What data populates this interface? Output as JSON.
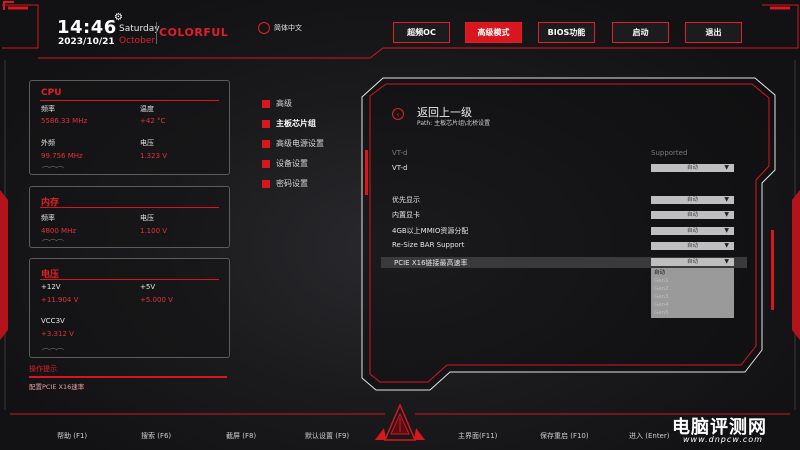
{
  "header": {
    "time": "14:46",
    "weekday": "Saturday",
    "date": "2023/10/21",
    "month": "October",
    "brand": "COLORFUL",
    "language": "简体中文"
  },
  "tabs": [
    {
      "label": "超频OC",
      "active": false
    },
    {
      "label": "高级模式",
      "active": true
    },
    {
      "label": "BIOS功能",
      "active": false
    },
    {
      "label": "启动",
      "active": false
    },
    {
      "label": "退出",
      "active": false
    }
  ],
  "cpu": {
    "title": "CPU",
    "freq_label": "频率",
    "freq_value": "5586.33 MHz",
    "temp_label": "温度",
    "temp_value": "+42 °C",
    "bclk_label": "外频",
    "bclk_value": "99.756 MHz",
    "volt_label": "电压",
    "volt_value": "1.323 V"
  },
  "memory": {
    "title": "内存",
    "freq_label": "频率",
    "freq_value": "4800 MHz",
    "volt_label": "电压",
    "volt_value": "1.100 V"
  },
  "voltage": {
    "title": "电压",
    "v12_label": "+12V",
    "v12_value": "+11.904 V",
    "v5_label": "+5V",
    "v5_value": "+5.000 V",
    "vcc3_label": "VCC3V",
    "vcc3_value": "+3.312 V"
  },
  "hint": {
    "title": "操作提示",
    "text": "配置PCIE X16速率"
  },
  "menu": [
    {
      "label": "高级",
      "active": false
    },
    {
      "label": "主板芯片组",
      "active": true
    },
    {
      "label": "高级电源设置",
      "active": false
    },
    {
      "label": "设备设置",
      "active": false
    },
    {
      "label": "密码设置",
      "active": false
    }
  ],
  "panel": {
    "back_label": "返回上一级",
    "path": "Path: 主板芯片组\\北桥设置"
  },
  "settings": {
    "vtd_header_label": "VT-d",
    "vtd_header_value": "Supported",
    "vtd_label": "VT-d",
    "vtd_value": "自动",
    "igpu_primary_label": "优先显示",
    "igpu_primary_value": "自动",
    "igpu_label": "内置显卡",
    "igpu_value": "自动",
    "mmio_label": "4GB以上MMIO资源分配",
    "mmio_value": "自动",
    "rebar_label": "Re-Size BAR Support",
    "rebar_value": "自动",
    "pcie_label": "PCIE X16链接最高速率",
    "pcie_value": "自动"
  },
  "dropdown_options": [
    "自动",
    "Gen1",
    "Gen2",
    "Gen3",
    "Gen4",
    "Gen5"
  ],
  "footer": {
    "help": "帮助 (F1)",
    "search": "搜索 (F6)",
    "screenshot": "截屏 (F8)",
    "defaults": "默认设置 (F9)",
    "main": "主界面(F11)",
    "save": "保存重启 (F10)",
    "enter": "进入 (Enter)"
  },
  "watermark": {
    "text": "电脑评测网",
    "url": "www.dnpcw.com"
  },
  "colors": {
    "accent": "#e21f26",
    "background": "#141416",
    "dropdown": "#bfbfbf"
  }
}
